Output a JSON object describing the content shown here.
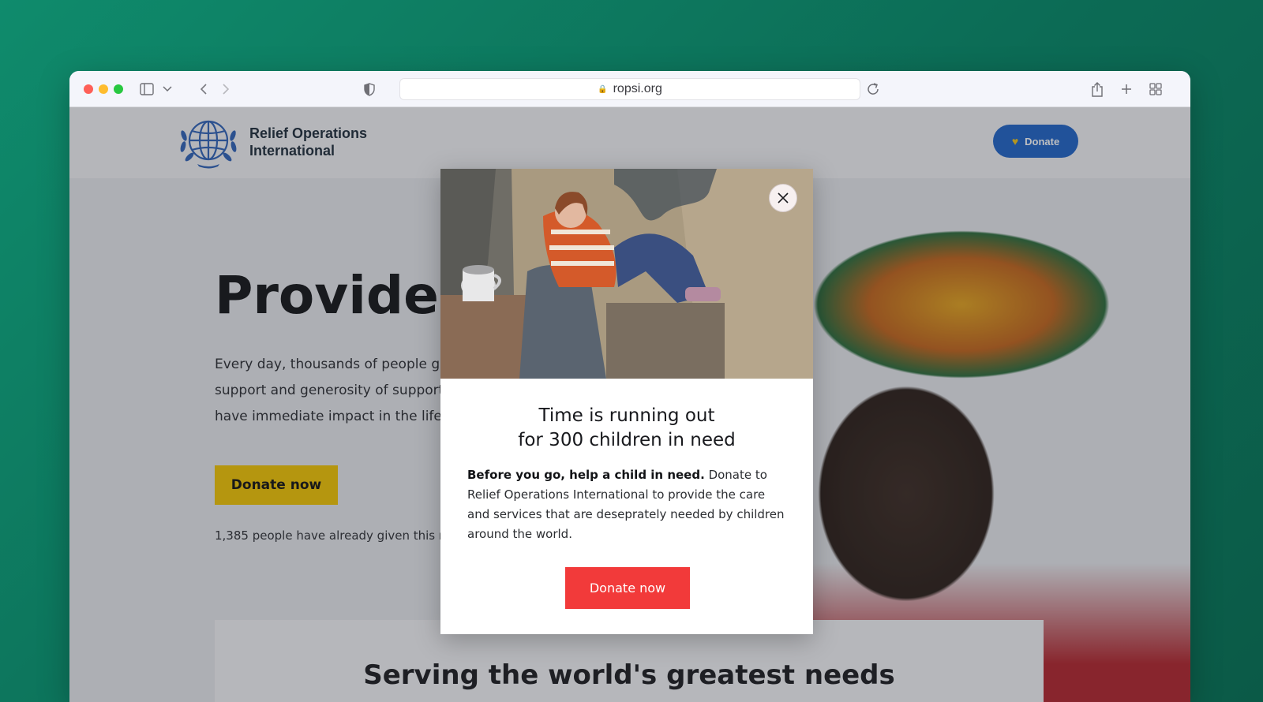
{
  "browser": {
    "url": "ropsi.org",
    "icons": [
      "sidebar-icon",
      "chevron-down-icon",
      "back-icon",
      "forward-icon",
      "shield-icon",
      "reload-icon",
      "share-icon",
      "plus-icon",
      "tabs-grid-icon"
    ]
  },
  "site": {
    "org_name_line1": "Relief Operations",
    "org_name_line2": "International",
    "header_donate_label": "Donate",
    "hero_title": "Provide F",
    "hero_copy_line1": "Every day, thousands of people get",
    "hero_copy_line2": "support and generosity of supporte",
    "hero_copy_line3": "have immediate impact in the life o",
    "hero_donate_label": "Donate now",
    "hero_count": "1,385 people have already given this m",
    "serving_title": "Serving the world's greatest needs"
  },
  "modal": {
    "title_line1": "Time is running out",
    "title_line2": "for 300 children in need",
    "body_bold": "Before you go, help a child in need.",
    "body_rest": " Donate to Relief Operations International to provide the care and services that are deseprately needed by children around the world.",
    "donate_label": "Donate now"
  },
  "colors": {
    "header_donate": "#1f63c8",
    "hero_donate": "#f2c400",
    "modal_donate": "#f23a3a"
  }
}
